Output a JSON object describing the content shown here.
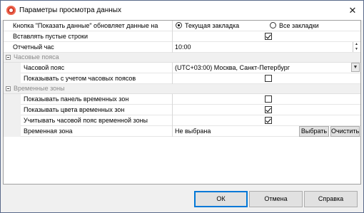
{
  "window": {
    "title": "Параметры просмотра данных",
    "close_glyph": "✕"
  },
  "rows": {
    "show_data_updates": {
      "label": "Кнопка \"Показать данные\" обновляет данные на",
      "option_current": "Текущая закладка",
      "option_all": "Все закладки",
      "selected": "Текущая закладка"
    },
    "insert_empty_rows": {
      "label": "Вставлять пустые строки",
      "checked": true
    },
    "report_hour": {
      "label": "Отчетный час",
      "value": "10:00"
    }
  },
  "categories": {
    "time_zones": {
      "label": "Часовые пояса",
      "expanded": true
    },
    "temporal_zones": {
      "label": "Временные зоны",
      "expanded": true
    }
  },
  "time_zone_rows": {
    "time_zone": {
      "label": "Часовой пояс",
      "value": "(UTC+03:00) Москва, Санкт-Петербург"
    },
    "show_with_time_zones": {
      "label": "Показывать с учетом часовых поясов",
      "checked": false
    }
  },
  "temporal_zone_rows": {
    "show_panel": {
      "label": "Показывать панель временных зон",
      "checked": false
    },
    "show_colors": {
      "label": "Показывать цвета временных зон",
      "checked": true
    },
    "consider_tz": {
      "label": "Учитывать часовой пояс временной зоны",
      "checked": true
    },
    "temporal_zone": {
      "label": "Временная зона",
      "value": "Не выбрана",
      "select_label": "Выбрать",
      "clear_label": "Очистить"
    }
  },
  "footer": {
    "ok_label": "ОК",
    "cancel_label": "Отмена",
    "help_label": "Справка"
  },
  "colors": {
    "accent": "#0078d7",
    "category_text": "#8a8a8a",
    "app_icon": "#d03a2a"
  },
  "icons": {
    "app": "app-icon",
    "close": "close-icon",
    "expand": "collapse-minus-icon",
    "dropdown": "chevron-down-icon",
    "spinner": "spinner-arrows-icon"
  }
}
